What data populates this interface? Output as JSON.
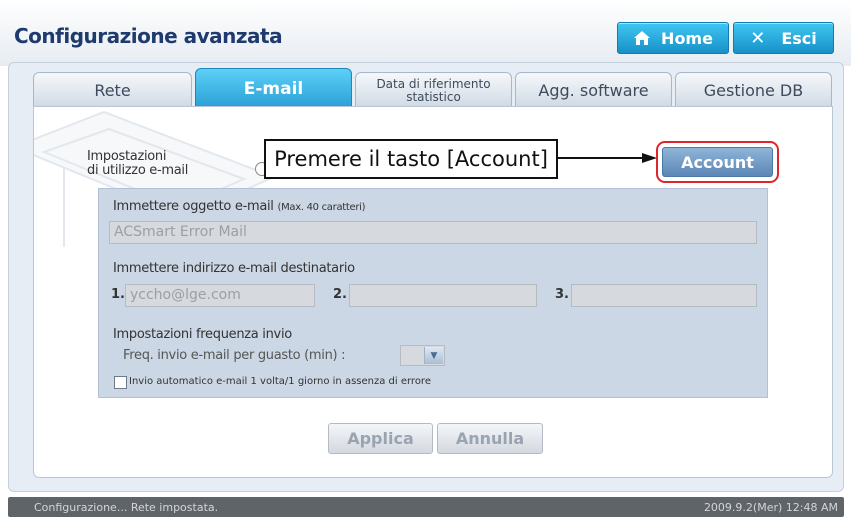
{
  "header": {
    "title": "Configurazione avanzata",
    "home_label": "Home",
    "exit_label": "Esci"
  },
  "tabs": [
    {
      "label": "Rete",
      "active": false
    },
    {
      "label": "E-mail",
      "active": true
    },
    {
      "label": "Data di riferimento statistico",
      "active": false
    },
    {
      "label": "Agg. software",
      "active": false
    },
    {
      "label": "Gestione DB",
      "active": false
    }
  ],
  "settings": {
    "label_line1": "Impostazioni",
    "label_line2": "di utilizzo e-mail"
  },
  "callout": "Premere il tasto [Account]",
  "account_label": "Account",
  "form": {
    "subject_label": "Immettere oggetto e-mail",
    "subject_hint": "(Max. 40 caratteri)",
    "subject_value": "ACSmart Error Mail",
    "recipient_label": "Immettere indirizzo e-mail destinatario",
    "recipients": [
      {
        "num": "1.",
        "value": "yccho@lge.com"
      },
      {
        "num": "2.",
        "value": ""
      },
      {
        "num": "3.",
        "value": ""
      }
    ],
    "frequency_label": "Impostazioni frequenza invio",
    "failure_freq_label": "Freq. invio e-mail per guasto (min) :",
    "failure_freq_value": "",
    "auto_send_label": "Invio automatico e-mail 1 volta/1 giorno in assenza di errore",
    "auto_send_checked": false
  },
  "buttons": {
    "apply": "Applica",
    "cancel": "Annulla"
  },
  "status": {
    "message": "Configurazione... Rete impostata.",
    "datetime": "2009.9.2(Mer)  12:48 AM"
  },
  "colors": {
    "accent": "#2a9fd6",
    "highlight": "#e0252a"
  }
}
